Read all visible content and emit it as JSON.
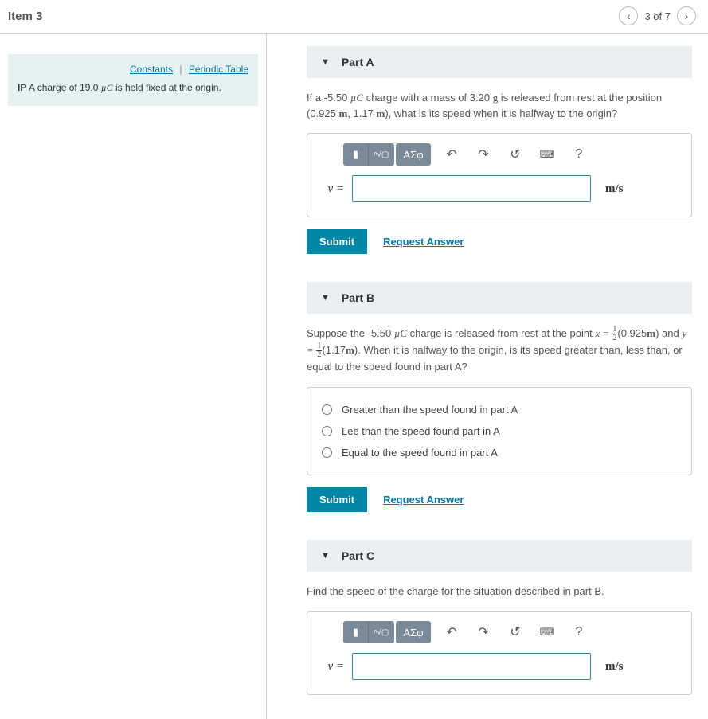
{
  "header": {
    "title": "Item 3",
    "position": "3 of 7"
  },
  "left": {
    "links": {
      "constants": "Constants",
      "periodic": "Periodic Table"
    },
    "ip": "IP",
    "problem_pre": "A charge of 19.0 ",
    "problem_unit": "µC",
    "problem_post": " is held fixed at the origin."
  },
  "partA": {
    "title": "Part A",
    "q_pre": "If a -5.50 ",
    "q_mid1": " charge with a mass of 3.20 ",
    "mass_unit": "g",
    "q_mid2": " is released from rest at the position (0.925 ",
    "m1": "m",
    "q_mid3": ", 1.17 ",
    "m2": "m",
    "q_post": "), what is its speed when it is halfway to the origin?",
    "var": "v =",
    "unit": "m/s",
    "submit": "Submit",
    "request": "Request Answer",
    "tb_greek": "ΑΣφ"
  },
  "partB": {
    "title": "Part B",
    "q_pre": "Suppose the -5.50 ",
    "q_mid1": " charge is released from rest at the point ",
    "x_eq": "x = ",
    "half1_n": "1",
    "half1_d": "2",
    "q_mid2": "(0.925",
    "m1": "m",
    "q_mid3": ") and ",
    "y_eq": "y =",
    "half2_n": "1",
    "half2_d": "2",
    "q_mid4": "(1.17",
    "m2": "m",
    "q_post": "). When it is halfway to the origin, is its speed greater than, less than, or equal to the speed found in part A?",
    "opt1": "Greater than the speed found in part A",
    "opt2": "Lee than the speed found part in A",
    "opt3": "Equal to the speed found  in part A",
    "submit": "Submit",
    "request": "Request Answer"
  },
  "partC": {
    "title": "Part C",
    "q": "Find the speed of the charge for the situation described in part B.",
    "var": "v =",
    "unit": "m/s",
    "tb_greek": "ΑΣφ"
  },
  "icons": {
    "rect": "▮",
    "root": "ⁿ√▢",
    "undo": "↶",
    "redo": "↷",
    "reset": "↺",
    "kbd": "⌨",
    "help": "?"
  }
}
